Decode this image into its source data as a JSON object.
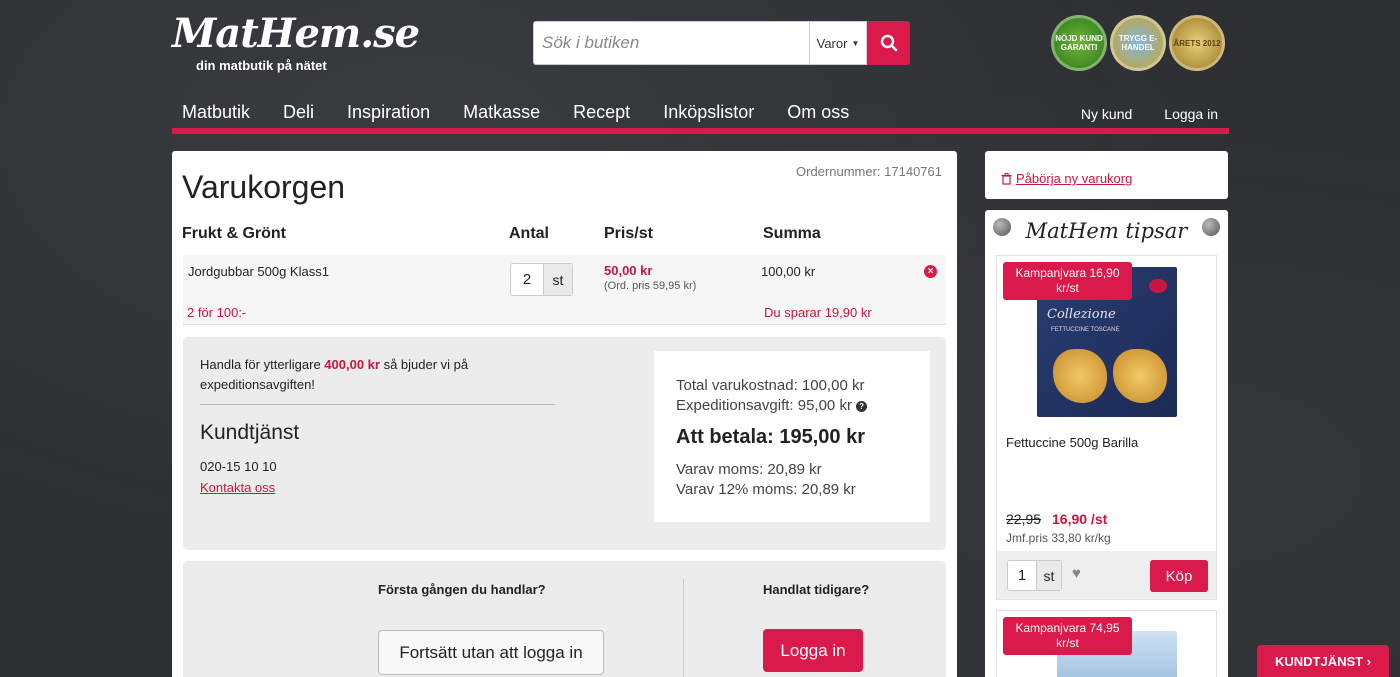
{
  "logo": {
    "main": "MatHem.se",
    "tagline": "din matbutik på nätet"
  },
  "search": {
    "placeholder": "Sök i butiken",
    "category": "Varor"
  },
  "badges": [
    {
      "text": "NÖJD KUND GARANTI"
    },
    {
      "text": "TRYGG E-HANDEL"
    },
    {
      "text": "ÅRETS 2012"
    }
  ],
  "nav": {
    "items": [
      "Matbutik",
      "Deli",
      "Inspiration",
      "Matkasse",
      "Recept",
      "Inköpslistor",
      "Om oss"
    ],
    "new_customer": "Ny kund",
    "login": "Logga in"
  },
  "cart": {
    "title": "Varukorgen",
    "order_number": "Ordernummer: 17140761",
    "headers": {
      "category": "Frukt & Grönt",
      "qty": "Antal",
      "price": "Pris/st",
      "sum": "Summa"
    },
    "item": {
      "name": "Jordgubbar 500g Klass1",
      "qty": "2",
      "unit": "st",
      "price": "50,00 kr",
      "ord_price": "(Ord. pris 59,95 kr)",
      "sum": "100,00 kr",
      "deal": "2 för 100:-",
      "saving": "Du sparar 19,90 kr"
    }
  },
  "fee_message": {
    "prefix": "Handla för ytterligare ",
    "amount": "400,00 kr",
    "suffix": " så bjuder vi på expeditionsavgiften!"
  },
  "customer_service": {
    "title": "Kundtjänst",
    "phone": "020-15 10 10",
    "link": "Kontakta oss"
  },
  "totals": {
    "goods": "Total varukostnad: 100,00 kr",
    "fee": "Expeditionsavgift: 95,00 kr",
    "to_pay": "Att betala: 195,00 kr",
    "vat": "Varav moms: 20,89 kr",
    "vat12": "Varav 12% moms: 20,89 kr"
  },
  "login_box": {
    "first_time": "Första gången du handlar?",
    "guest_button": "Fortsätt utan att logga in",
    "returning": "Handlat tidigare?",
    "login_button": "Logga in"
  },
  "sidebar": {
    "new_cart": "Påbörja ny varukorg",
    "tips_title": "MatHem tipsar",
    "products": [
      {
        "promo": "Kampanjvara 16,90 kr/st",
        "box_title": "Collezione",
        "box_sub": "FETTUCCINE TOSCANE",
        "name": "Fettuccine 500g Barilla",
        "old_price": "22,95",
        "new_price": "16,90 /st",
        "unit_price": "Jmf.pris 33,80 kr/kg",
        "qty": "1",
        "unit": "st",
        "buy": "Köp"
      },
      {
        "promo": "Kampanjvara 74,95 kr/st"
      }
    ]
  },
  "kundtjanst_tab": "KUNDTJÄNST ›",
  "colors": {
    "accent": "#d91a4a",
    "background": "#2d2f33"
  }
}
